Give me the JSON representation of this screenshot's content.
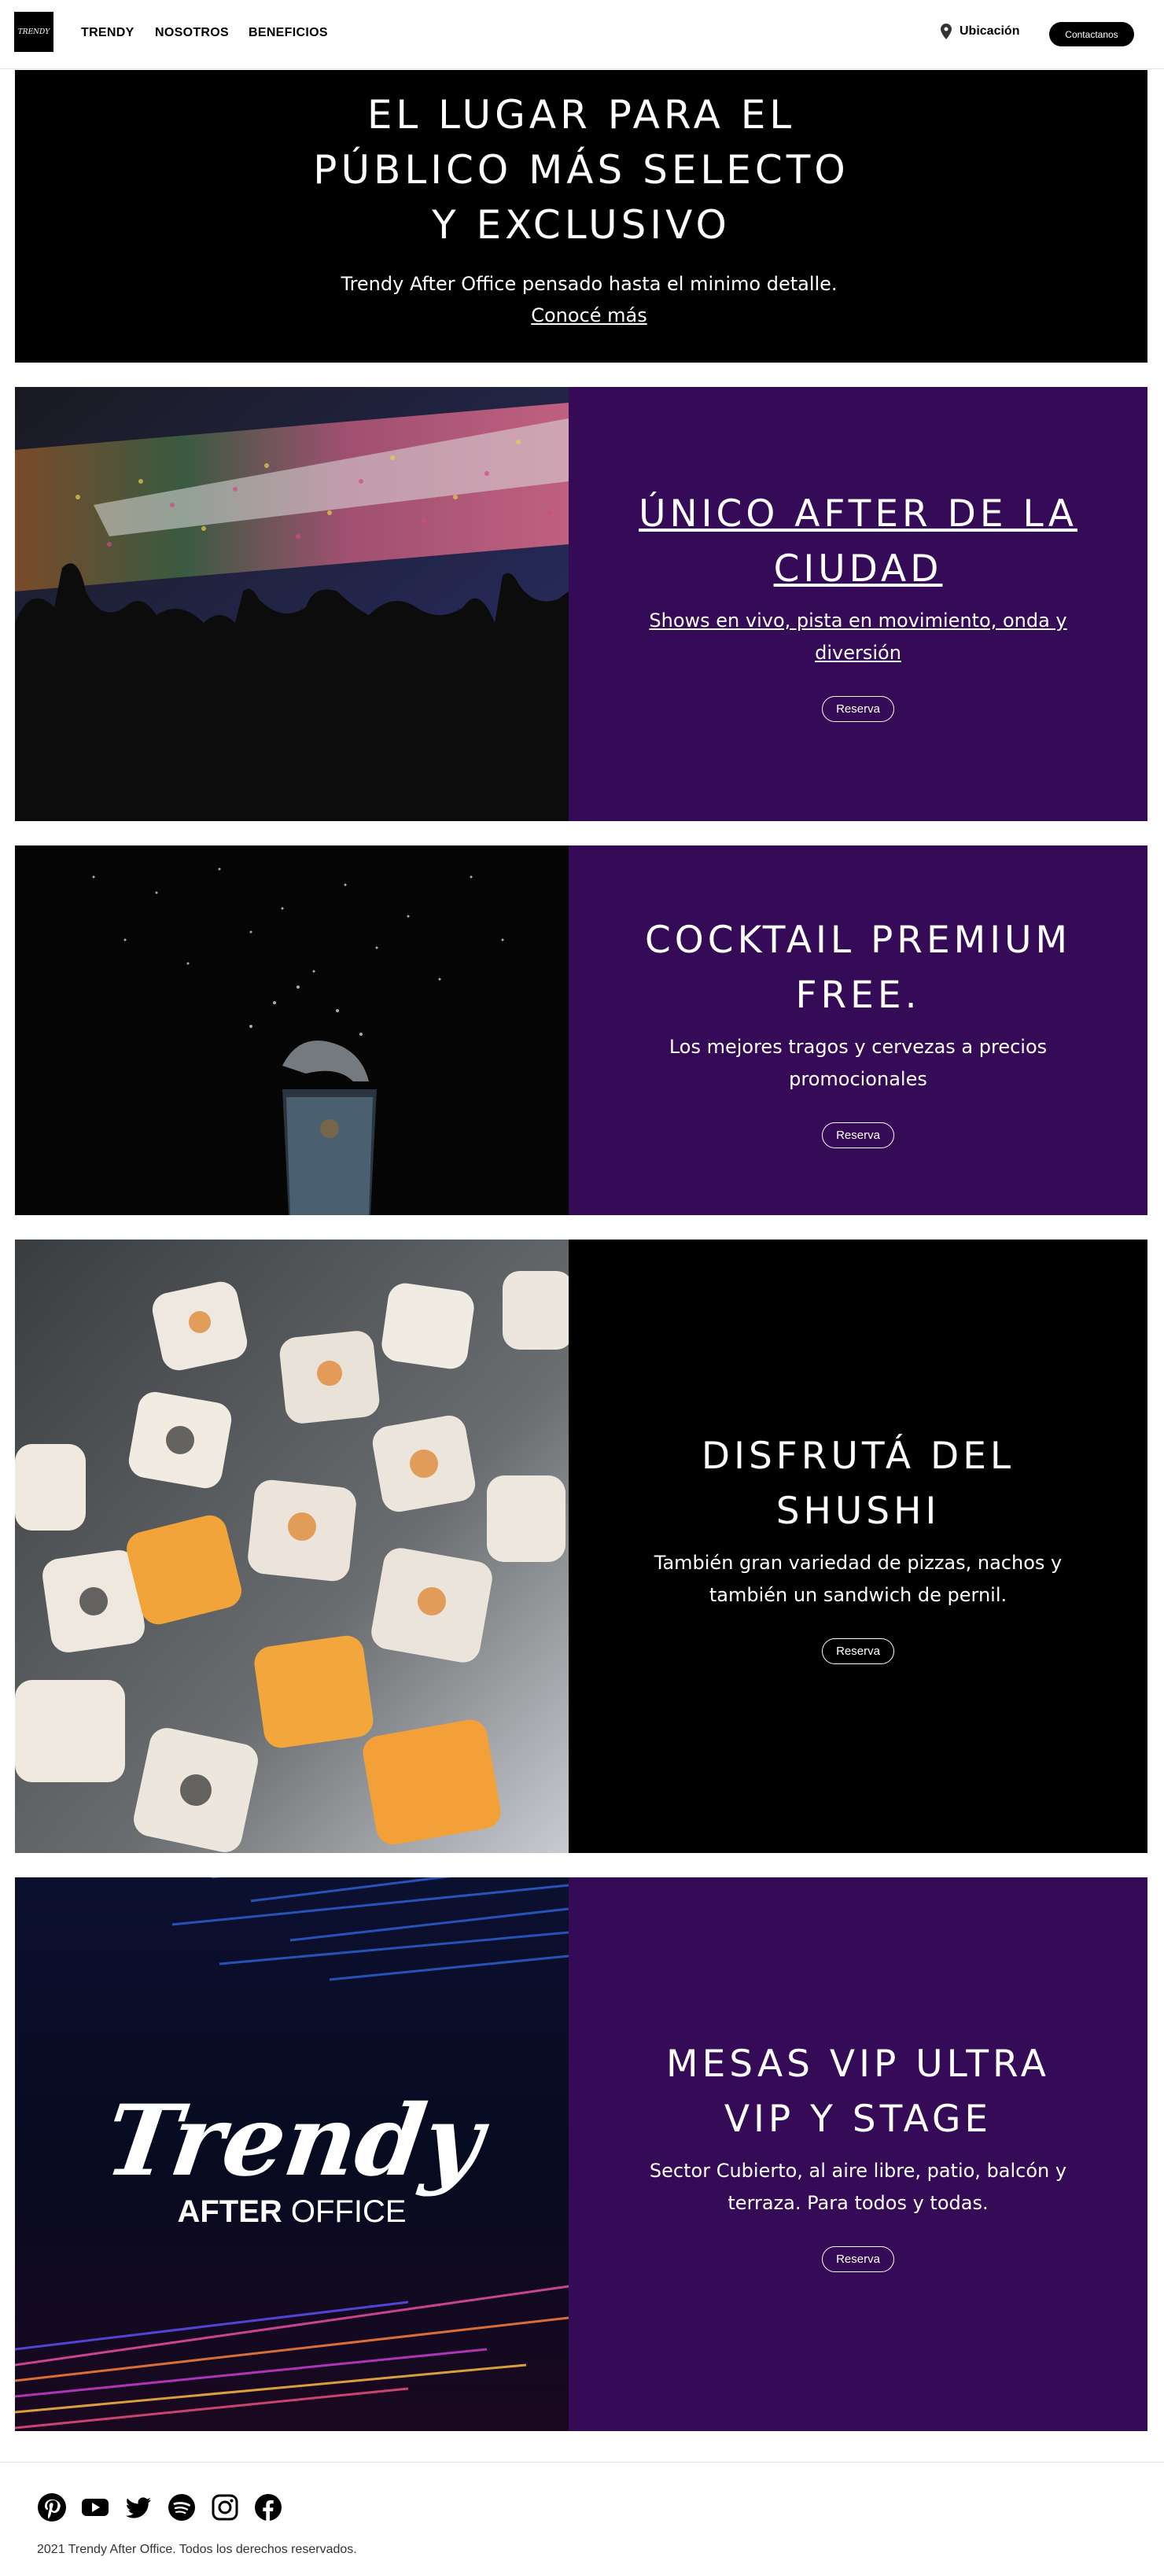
{
  "nav": {
    "logo_text": "TRENDY",
    "links": [
      "TRENDY",
      "NOSOTROS",
      "BENEFICIOS"
    ],
    "location_label": "Ubicación",
    "contact_label": "Contactanos"
  },
  "hero": {
    "title_line1": "EL LUGAR PARA EL",
    "title_line2": "PÚBLICO MÁS SELECTO",
    "title_line3": "Y EXCLUSIVO",
    "subtitle": "Trendy After Office pensado hasta el minimo detalle. ",
    "link_text": "Conocé más"
  },
  "sections": [
    {
      "title": "ÚNICO AFTER DE LA CIUDAD",
      "desc": "Shows en vivo, pista en movimiento, onda y diversión",
      "button": "Reserva",
      "image": "concert-crowd-image"
    },
    {
      "title": "COCKTAIL PREMIUM FREE.",
      "desc": "Los mejores tragos y cervezas a precios promocionales",
      "button": "Reserva",
      "image": "cocktail-splash-image"
    },
    {
      "title": "DISFRUTÁ DEL SHUSHI",
      "desc": "También gran variedad de pizzas, nachos y también un sandwich de pernil.",
      "button": "Reserva",
      "image": "sushi-image"
    },
    {
      "title": "MESAS VIP ULTRA VIP Y STAGE",
      "desc": "Sector Cubierto, al aire libre, patio, balcón y terraza. Para todos y todas.",
      "button": "Reserva",
      "image": "trendy-logo-image",
      "logo_script": "Trendy",
      "logo_sub_bold": "AFTER",
      "logo_sub_light": "OFFICE"
    }
  ],
  "footer": {
    "socials": [
      "pinterest-icon",
      "youtube-icon",
      "twitter-icon",
      "spotify-icon",
      "instagram-icon",
      "facebook-icon"
    ],
    "copyright": "2021 Trendy After Office. Todos los derechos reservados."
  },
  "colors": {
    "purple": "#350a57",
    "black": "#000000"
  }
}
